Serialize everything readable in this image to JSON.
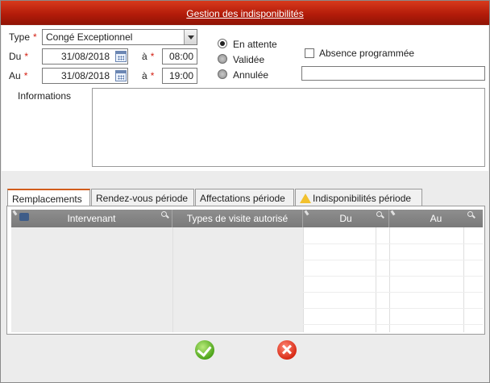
{
  "window": {
    "title": "Gestion des indisponibilités"
  },
  "form": {
    "type_label": "Type",
    "required_mark": "*",
    "type_value": "Congé Exceptionnel",
    "du_label": "Du",
    "du_date": "31/08/2018",
    "du_time_label": "à",
    "du_time": "08:00",
    "au_label": "Au",
    "au_date": "31/08/2018",
    "au_time_label": "à",
    "au_time": "19:00",
    "status": [
      {
        "label": "En attente",
        "selected": true
      },
      {
        "label": "Validée",
        "selected": false
      },
      {
        "label": "Annulée",
        "selected": false
      }
    ],
    "absence_label": "Absence programmée",
    "absence_checked": false,
    "absence_text": "",
    "informations_label": "Informations",
    "informations_value": ""
  },
  "tabs": [
    {
      "label": "Remplacements",
      "active": true
    },
    {
      "label": "Rendez-vous période",
      "active": false
    },
    {
      "label": "Affectations période",
      "active": false
    },
    {
      "label": "Indisponibilités période",
      "active": false,
      "icon": "warning-icon"
    }
  ],
  "grid": {
    "columns": [
      "Intervenant",
      "Types de visite autorisé",
      "Du",
      "Au"
    ],
    "rows": []
  },
  "actions": {
    "confirm_icon": "confirm-icon",
    "cancel_icon": "cancel-icon"
  },
  "colors": {
    "titlebar": "#b31c0a",
    "required": "#d31f12",
    "active_tab": "#d25d1d"
  }
}
